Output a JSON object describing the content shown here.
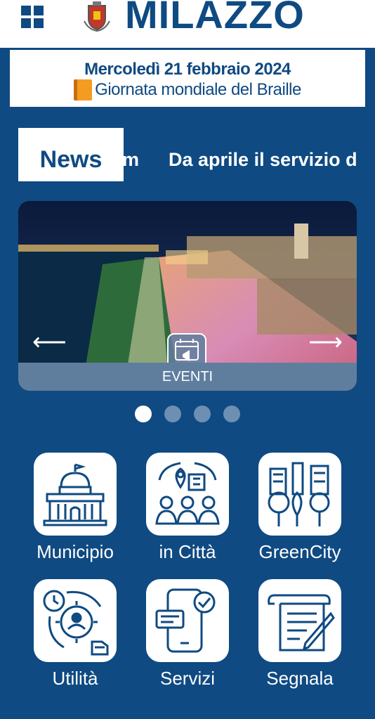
{
  "header": {
    "brand": "MILAZZO",
    "menu_icon": "grid-menu-icon",
    "crest_icon": "city-crest-icon"
  },
  "day_banner": {
    "date": "Mercoledì 21 febbraio 2024",
    "event": "Giornata mondiale del Braille",
    "icon": "book-icon"
  },
  "news": {
    "label": "News",
    "ticker_fragment": "m",
    "ticker_text": "Da aprile il servizio d"
  },
  "carousel": {
    "caption": "EVENTI",
    "icon": "calendar-megaphone-icon",
    "slide_count": 4,
    "active_slide": 1
  },
  "tiles": [
    {
      "label": "Municipio",
      "icon": "town-hall-icon"
    },
    {
      "label": "in Città",
      "icon": "city-people-icon"
    },
    {
      "label": "GreenCity",
      "icon": "green-city-icon"
    },
    {
      "label": "Utilità",
      "icon": "utility-gear-icon"
    },
    {
      "label": "Servizi",
      "icon": "smartphone-services-icon"
    },
    {
      "label": "Segnala",
      "icon": "report-document-icon"
    }
  ],
  "colors": {
    "brand_blue": "#0f4a82",
    "white": "#ffffff",
    "caption_bar": "#5f7e9e"
  }
}
